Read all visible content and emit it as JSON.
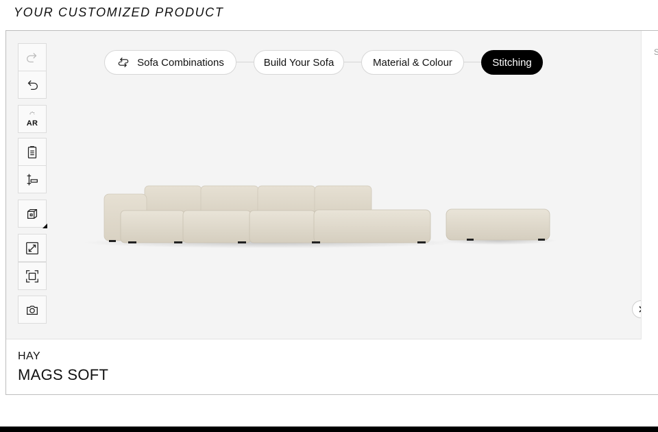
{
  "page": {
    "heading": "YOUR CUSTOMIZED PRODUCT"
  },
  "toolbar": {
    "items": [
      {
        "name": "redo",
        "icon": "redo-icon",
        "enabled": false
      },
      {
        "name": "undo",
        "icon": "undo-icon",
        "enabled": true
      },
      {
        "name": "ar",
        "icon": "ar-icon",
        "label": "AR",
        "enabled": true
      },
      {
        "name": "summary",
        "icon": "clipboard-icon",
        "enabled": true
      },
      {
        "name": "dimensions",
        "icon": "ruler-icon",
        "enabled": true
      },
      {
        "name": "view-options",
        "icon": "cube-icon",
        "enabled": true
      },
      {
        "name": "fullscreen",
        "icon": "expand-icon",
        "enabled": true
      },
      {
        "name": "fit-view",
        "icon": "frame-icon",
        "enabled": true
      },
      {
        "name": "screenshot",
        "icon": "camera-icon",
        "enabled": true
      }
    ]
  },
  "steps": [
    {
      "label": "Sofa Combinations",
      "icon": "swap-icon",
      "active": false
    },
    {
      "label": "Build Your Sofa",
      "active": false
    },
    {
      "label": "Material & Colour",
      "active": false
    },
    {
      "label": "Stitching",
      "active": true
    }
  ],
  "side_panel": {
    "label": "S"
  },
  "product": {
    "brand": "HAY",
    "name": "MAGS SOFT",
    "fabric_color": "#e3ddd0"
  },
  "colors": {
    "viewer_bg": "#f4f4f4",
    "active_step_bg": "#000000"
  }
}
